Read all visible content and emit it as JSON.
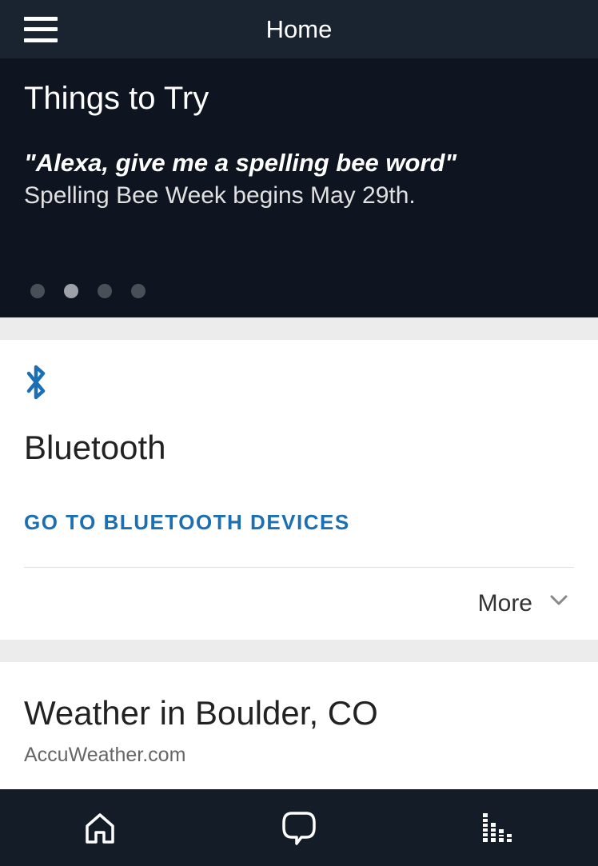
{
  "header": {
    "title": "Home"
  },
  "carousel": {
    "title": "Things to Try",
    "quote": "\"Alexa, give me a spelling bee word\"",
    "subtitle": "Spelling Bee Week begins May 29th.",
    "activeIndex": 1,
    "dotCount": 4
  },
  "bluetooth": {
    "title": "Bluetooth",
    "link": "GO TO BLUETOOTH DEVICES",
    "more": "More"
  },
  "weather": {
    "title": "Weather in Boulder, CO",
    "source": "AccuWeather.com"
  }
}
